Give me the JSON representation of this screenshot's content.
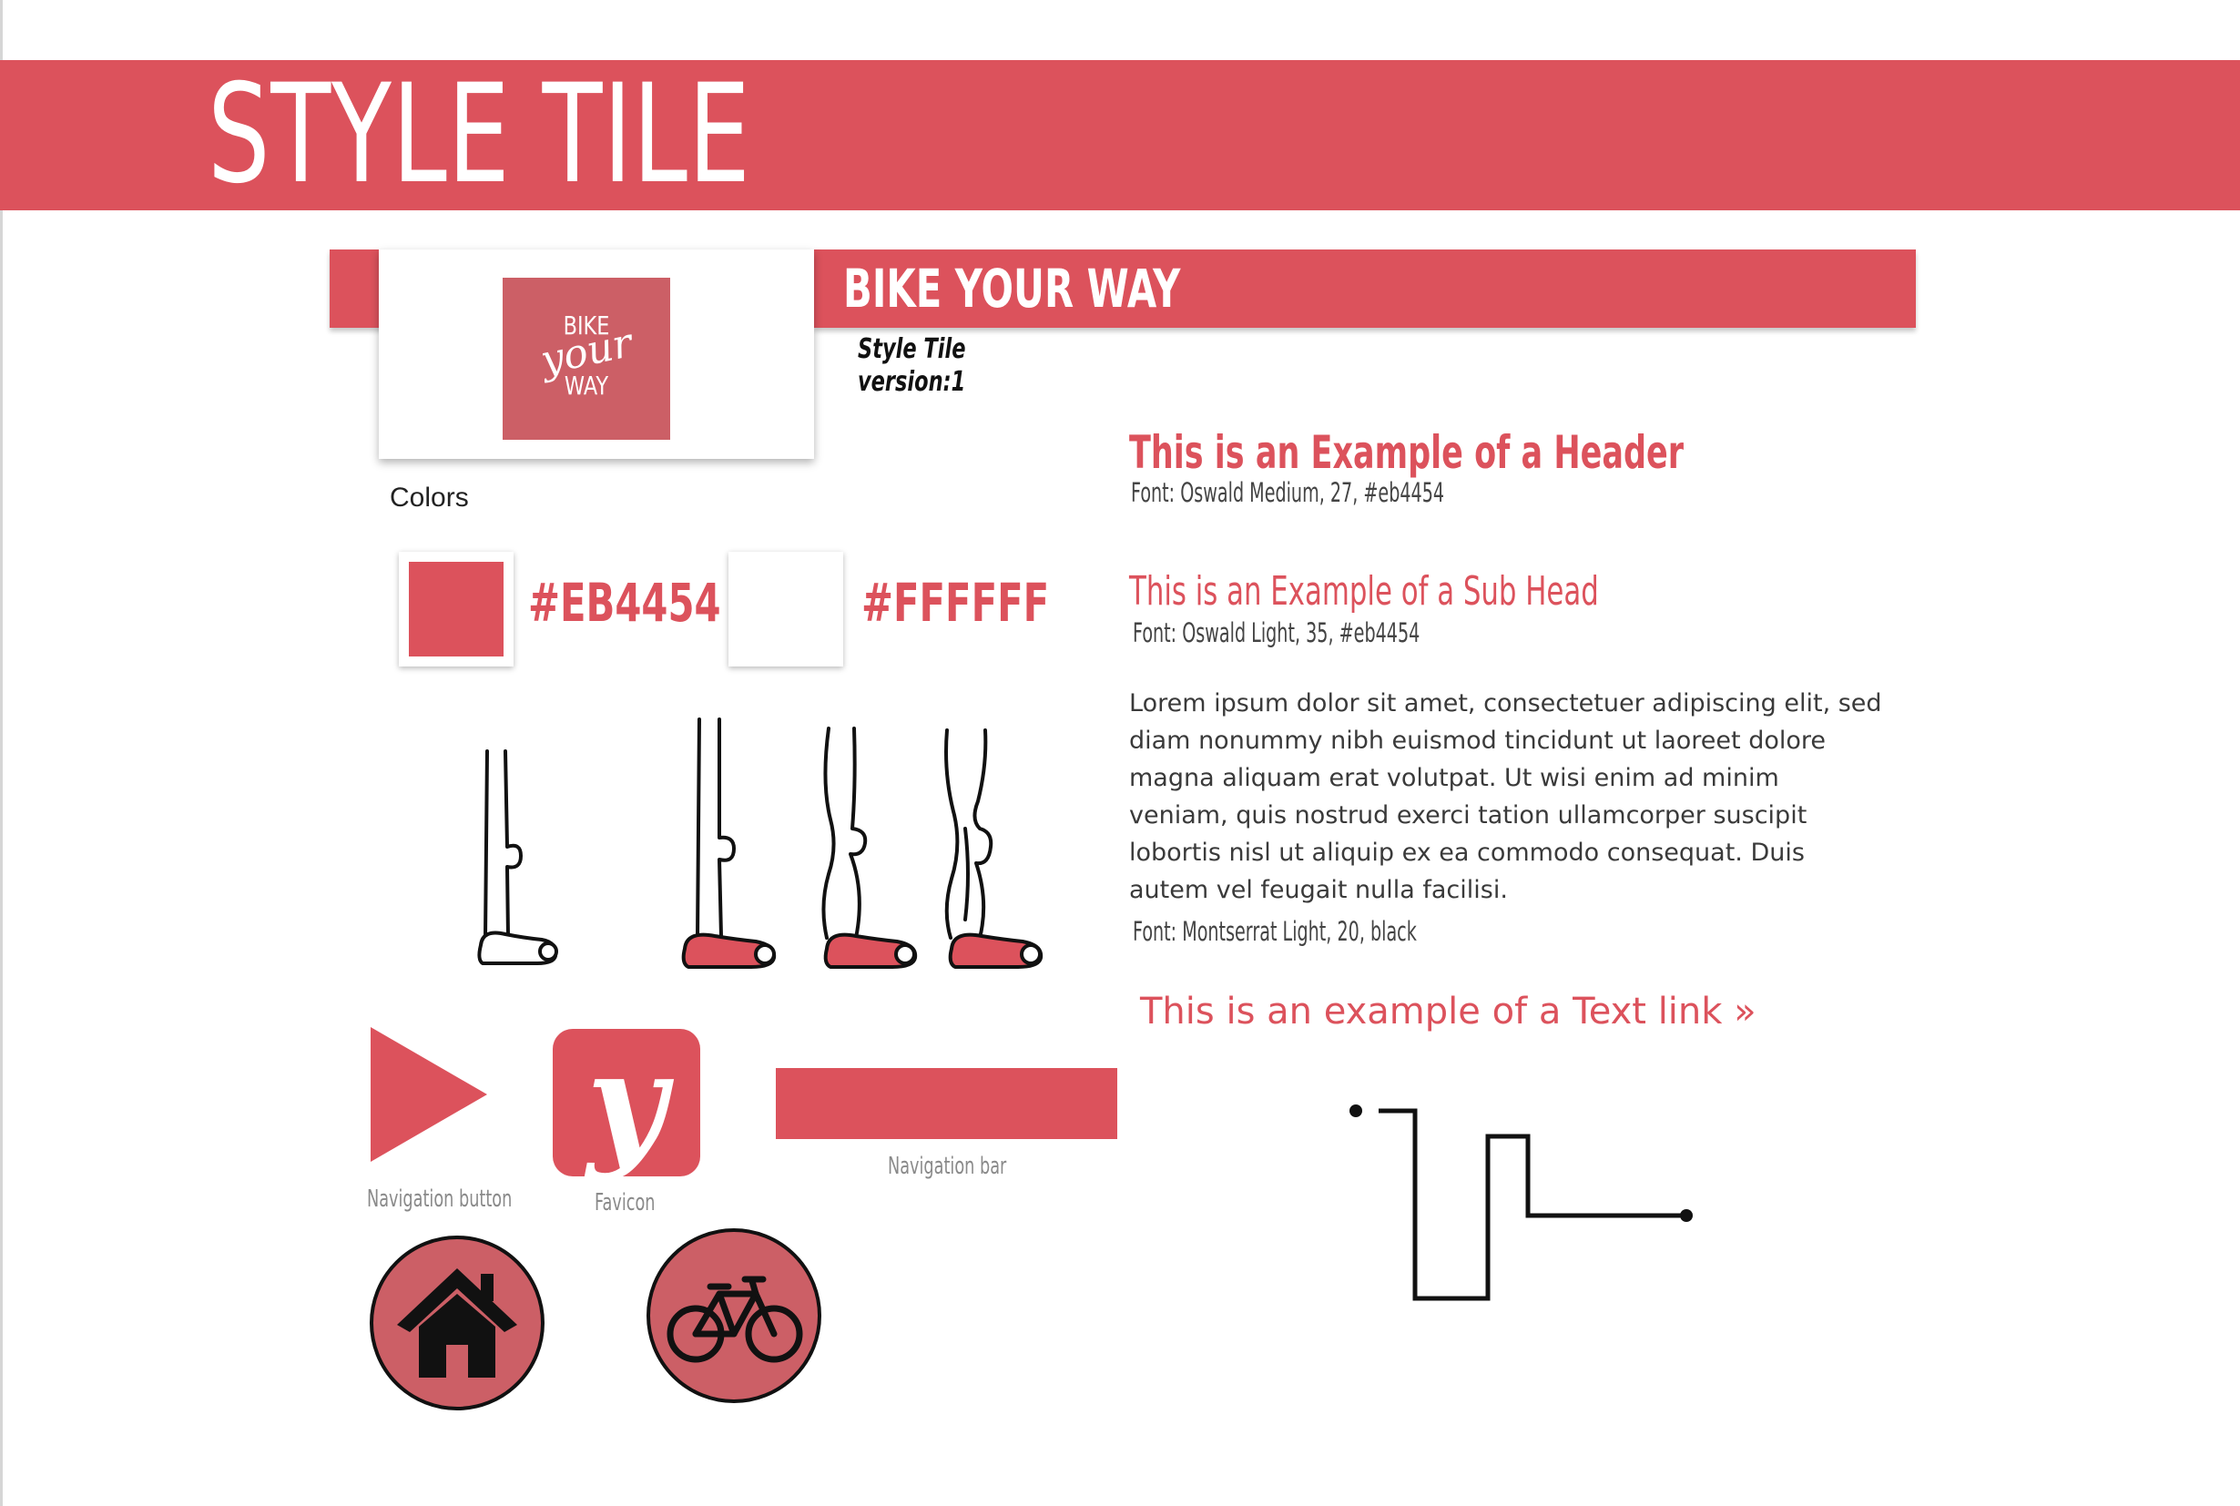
{
  "page": {
    "title": "STYLE TILE"
  },
  "brand": {
    "name": "BIKE YOUR WAY",
    "tile_label": "Style Tile",
    "version": "version:1",
    "logo_line1": "BIKE",
    "logo_line2": "your",
    "logo_line3": "WAY"
  },
  "colors": {
    "label": "Colors",
    "swatches": [
      {
        "hex": "#EB4454",
        "fill": "#dc525c"
      },
      {
        "hex": "#FFFFFF",
        "fill": "#ffffff"
      }
    ]
  },
  "elements": {
    "nav_button_caption": "Navigation button",
    "favicon_caption": "Favicon",
    "favicon_glyph": "y",
    "navbar_caption": "Navigation bar"
  },
  "icons": [
    "play-triangle-icon",
    "home-icon",
    "bicycle-icon"
  ],
  "typography": {
    "header": {
      "text": "This is an Example of a Header",
      "spec": "Font: Oswald Medium, 27, #eb4454"
    },
    "subhead": {
      "text": "This is an Example of a Sub Head",
      "spec": "Font: Oswald Light, 35, #eb4454"
    },
    "body": {
      "text": "Lorem ipsum dolor sit amet, consectetuer adipiscing elit, sed diam nonummy nibh euismod tincidunt ut laoreet dolore magna aliquam erat volutpat. Ut wisi enim ad minim veniam, quis nostrud exerci tation ullamcorper suscipit lobortis nisl ut aliquip ex ea commodo consequat. Duis autem vel feugait nulla facilisi.",
      "spec": "Font: Montserrat Light, 20, black"
    },
    "link": {
      "text": "This is an example of a Text link »"
    }
  },
  "accent_color": "#dc525c"
}
